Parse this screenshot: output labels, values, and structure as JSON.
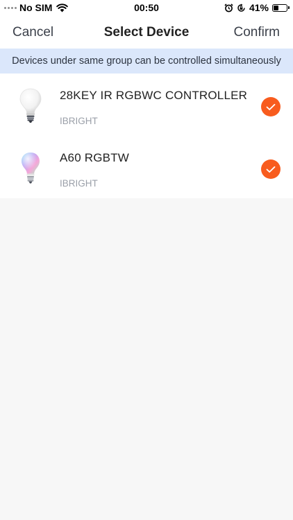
{
  "status_bar": {
    "carrier": "No SIM",
    "time": "00:50",
    "battery_percent": "41%",
    "battery_level": 0.41,
    "icons": [
      "signal-dots-icon",
      "wifi-icon",
      "alarm-icon",
      "orientation-lock-icon",
      "battery-icon"
    ]
  },
  "nav": {
    "cancel_label": "Cancel",
    "title": "Select Device",
    "confirm_label": "Confirm"
  },
  "banner": {
    "text": "Devices under same group can be controlled simultaneously"
  },
  "devices": [
    {
      "name": "28KEY IR RGBWC CONTROLLER",
      "brand": "IBRIGHT",
      "icon": "white-bulb-icon",
      "selected": true
    },
    {
      "name": "A60 RGBTW",
      "brand": "IBRIGHT",
      "icon": "rgb-bulb-icon",
      "selected": true
    }
  ],
  "colors": {
    "accent": "#f85c1e",
    "banner_bg": "#dbe7fb",
    "page_bg": "#f7f7f7"
  }
}
